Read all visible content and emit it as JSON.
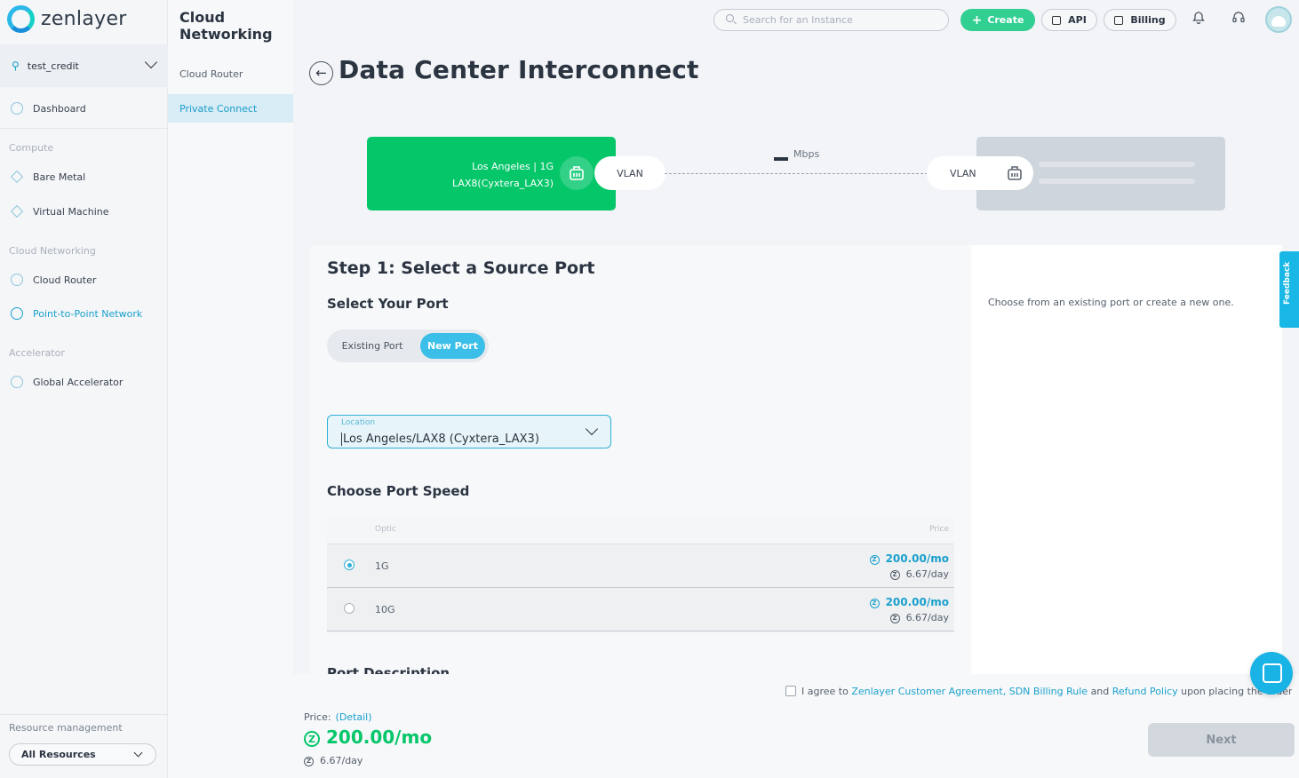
{
  "brand": {
    "name": "zenlayer",
    "accent": "#1aa0cc",
    "green": "#06c66a"
  },
  "account": {
    "name": "test_credit"
  },
  "sidebar": {
    "dashboard": "Dashboard",
    "groups": {
      "compute": "Compute",
      "cloud_networking": "Cloud Networking",
      "accelerator": "Accelerator"
    },
    "items": {
      "bare_metal": "Bare Metal",
      "virtual_machine": "Virtual Machine",
      "cloud_router": "Cloud Router",
      "p2p": "Point-to-Point Network",
      "global_accelerator": "Global Accelerator"
    },
    "resource_label": "Resource management",
    "resource_select": "All Resources"
  },
  "subnav": {
    "title": "Cloud Networking",
    "items": [
      "Cloud Router",
      "Private Connect"
    ],
    "active": "Private Connect"
  },
  "topbar": {
    "search_placeholder": "Search for an Instance",
    "create": "Create",
    "api": "API",
    "billing": "Billing"
  },
  "page": {
    "title": "Data Center Interconnect"
  },
  "diagram": {
    "source_line1": "Los Angeles | 1G",
    "source_line2": "LAX8(Cyxtera_LAX3)",
    "vlan_left": "VLAN",
    "vlan_right": "VLAN",
    "speed_unit": "Mbps"
  },
  "step": {
    "title": "Step 1: Select a Source Port",
    "select_port": "Select Your Port",
    "toggle": {
      "existing": "Existing Port",
      "new": "New Port",
      "selected": "New Port"
    },
    "location_label": "Location",
    "location_value": "Los Angeles/LAX8 (Cyxtera_LAX3)",
    "speed_title": "Choose Port Speed",
    "table": {
      "headers": {
        "optic": "Optic",
        "price": "Price"
      },
      "rows": [
        {
          "optic": "1G",
          "monthly": "200.00/mo",
          "daily": "6.67/day",
          "selected": true
        },
        {
          "optic": "10G",
          "monthly": "200.00/mo",
          "daily": "6.67/day",
          "selected": false
        }
      ]
    },
    "next_section": "Port Description"
  },
  "side_help": "Choose from an existing port or create a new one.",
  "footer": {
    "agree_prefix": "I agree to",
    "link1": "Zenlayer Customer Agreement,",
    "link2": "SDN Billing Rule",
    "and": "and",
    "link3": "Refund Policy",
    "agree_suffix": "upon placing the order.",
    "price_label": "Price:",
    "detail": "(Detail)",
    "price_monthly": "200.00/mo",
    "price_daily": "6.67/day",
    "next": "Next"
  },
  "feedback": "Feedback"
}
